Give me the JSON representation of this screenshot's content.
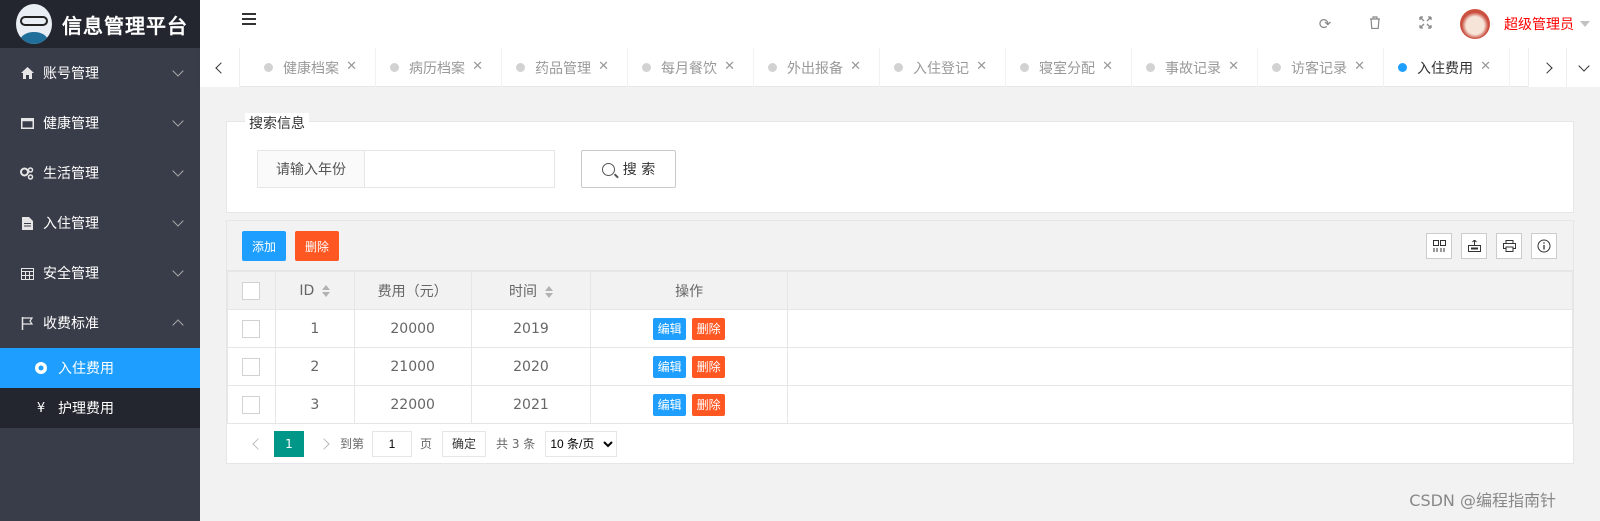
{
  "app": {
    "title": "信息管理平台"
  },
  "sidebar": {
    "items": [
      {
        "label": "账号管理",
        "icon": "home-icon"
      },
      {
        "label": "健康管理",
        "icon": "window-icon"
      },
      {
        "label": "生活管理",
        "icon": "gears-icon"
      },
      {
        "label": "入住管理",
        "icon": "file-icon"
      },
      {
        "label": "安全管理",
        "icon": "calendar-icon"
      },
      {
        "label": "收费标准",
        "icon": "flag-icon"
      }
    ],
    "subitems": [
      {
        "label": "入住费用",
        "icon": "dot-circle-icon",
        "active": true
      },
      {
        "label": "护理费用",
        "icon": "yen-icon",
        "active": false
      }
    ]
  },
  "header": {
    "user_name": "超级管理员",
    "icons": [
      "refresh-icon",
      "trash-icon",
      "fullscreen-icon"
    ]
  },
  "tabs": [
    {
      "label": "健康档案",
      "active": false
    },
    {
      "label": "病历档案",
      "active": false
    },
    {
      "label": "药品管理",
      "active": false
    },
    {
      "label": "每月餐饮",
      "active": false
    },
    {
      "label": "外出报备",
      "active": false
    },
    {
      "label": "入住登记",
      "active": false
    },
    {
      "label": "寝室分配",
      "active": false
    },
    {
      "label": "事故记录",
      "active": false
    },
    {
      "label": "访客记录",
      "active": false
    },
    {
      "label": "入住费用",
      "active": true
    }
  ],
  "search": {
    "legend": "搜索信息",
    "label": "请输入年份",
    "value": "",
    "button": "搜 索"
  },
  "toolbar": {
    "add": "添加",
    "delete": "删除"
  },
  "table": {
    "columns": [
      "ID",
      "费用（元）",
      "时间",
      "操作"
    ],
    "rows": [
      {
        "id": "1",
        "fee": "20000",
        "year": "2019"
      },
      {
        "id": "2",
        "fee": "21000",
        "year": "2020"
      },
      {
        "id": "3",
        "fee": "22000",
        "year": "2021"
      }
    ],
    "edit": "编辑",
    "delete": "删除"
  },
  "pager": {
    "current": "1",
    "goto": "到第",
    "page_input": "1",
    "page_unit": "页",
    "confirm": "确定",
    "total": "共 3 条",
    "page_size": "10 条/页"
  },
  "watermark": "CSDN @编程指南针"
}
